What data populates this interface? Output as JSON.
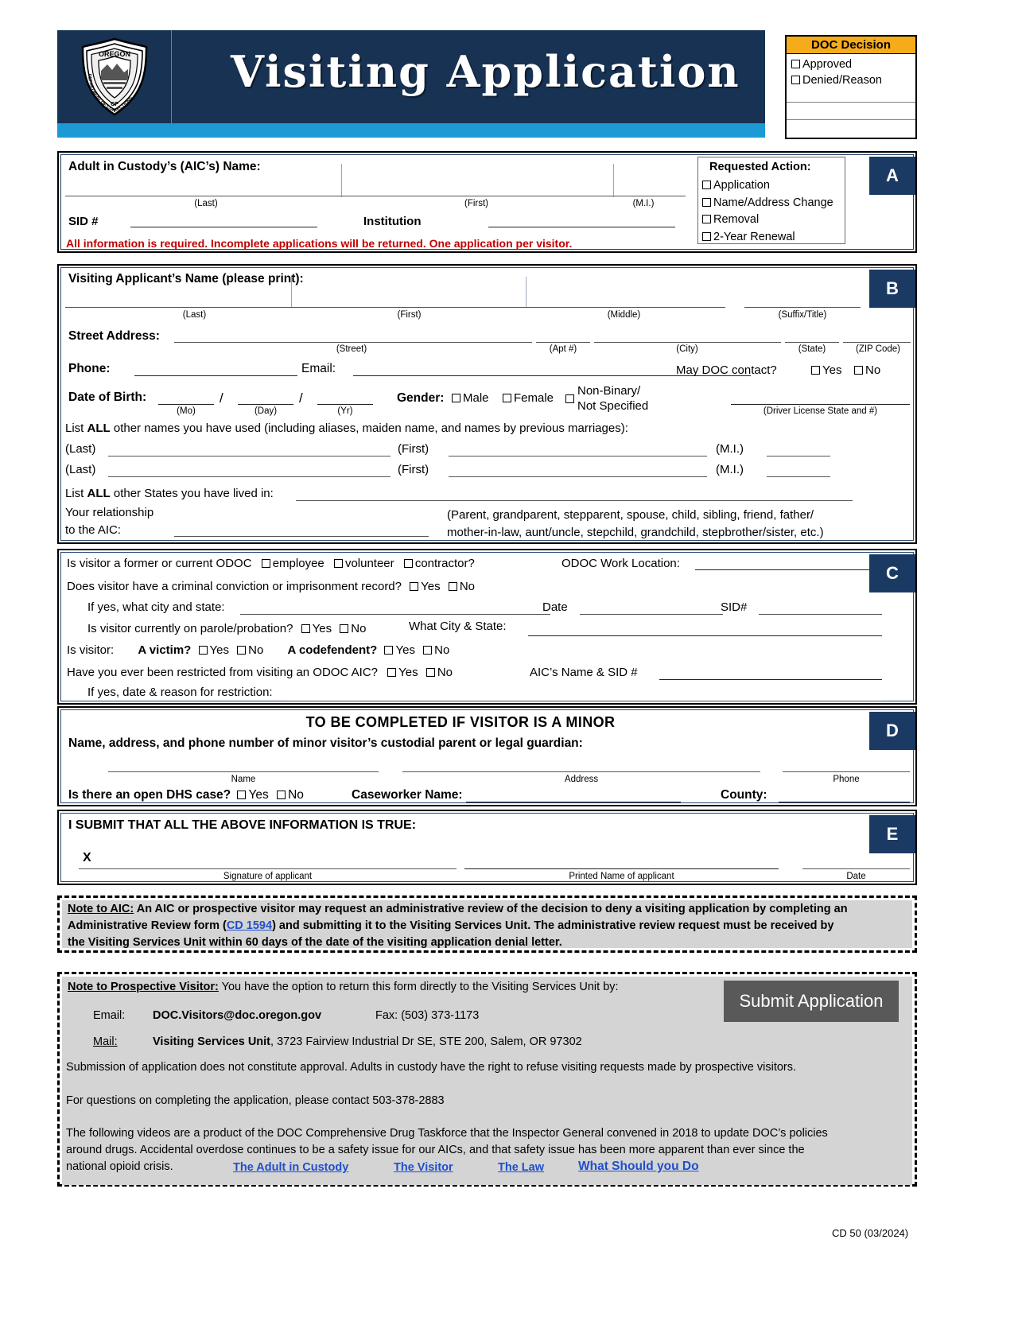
{
  "header": {
    "title": "Visiting Application",
    "logo_alt": "oregon-department-of-corrections-seal",
    "logo_text_top": "OREGON",
    "logo_text_arc": "DEPARTMENT OF CORRECTIONS",
    "logo_text_bottom": "OF"
  },
  "doc_decision": {
    "title": "DOC Decision",
    "options": [
      "Approved",
      "Denied/Reason"
    ]
  },
  "section_a": {
    "tag": "A",
    "aic_name_label": "Adult in Custody’s (AIC’s) Name:",
    "captions": [
      "(Last)",
      "(First)",
      "(M.I.)"
    ],
    "sid_label": "SID #",
    "institution_label": "Institution",
    "warning": "All information is required. Incomplete applications will be returned. One application per visitor.",
    "requested_action": {
      "title": "Requested Action:",
      "options": [
        "Application",
        "Name/Address Change",
        "Removal",
        "2-Year Renewal"
      ]
    }
  },
  "section_b": {
    "tag": "B",
    "applicant_name_label": "Visiting Applicant’s Name (please print):",
    "name_captions": [
      "(Last)",
      "(First)",
      "(Middle)",
      "(Suffix/Title)"
    ],
    "street_address_label": "Street Address:",
    "address_captions": [
      "(Street)",
      "(Apt #)",
      "(City)",
      "(State)",
      "(ZIP Code)"
    ],
    "phone_label": "Phone:",
    "email_label": "Email:",
    "may_doc_contact_label": "May DOC contact?",
    "yes_label": "Yes",
    "no_label": "No",
    "dob_label": "Date of Birth:",
    "dob_captions": [
      "(Mo)",
      "(Day)",
      "(Yr)"
    ],
    "gender_label": "Gender:",
    "gender_options": [
      "Male",
      "Female"
    ],
    "gender_nonbinary_line1": "Non-Binary/",
    "gender_nonbinary_line2": "Not Specified",
    "driver_license_caption": "(Driver License State and #)",
    "other_names_prefix": "List ",
    "other_names_all": "ALL",
    "other_names_suffix": " other names you have used (including aliases, maiden name, and names by previous marriages):",
    "name_row_labels": [
      "(Last)",
      "(First)",
      "(M.I.)"
    ],
    "other_states_prefix": "List ",
    "other_states_all": "ALL",
    "other_states_suffix": " other States you have lived in:",
    "relationship_line1": "Your relationship",
    "relationship_line2": "to the AIC:",
    "relationship_hint_line1": "(Parent, grandparent, stepparent, spouse, child, sibling, friend, father/",
    "relationship_hint_line2": "mother-in-law, aunt/uncle, stepchild, grandchild, stepbrother/sister, etc.)"
  },
  "section_c": {
    "tag": "C",
    "odoc_q": "Is visitor a former or current ODOC",
    "odoc_options": [
      "employee",
      "volunteer",
      "contractor?"
    ],
    "work_location_label": "ODOC Work Location:",
    "conviction_q": "Does visitor have a criminal conviction or imprisonment record?",
    "yes_label": "Yes",
    "no_label": "No",
    "if_yes_city_state": "If yes, what city and state:",
    "date_label": "Date",
    "sid_label": "SID#",
    "parole_q": "Is visitor currently on parole/probation?",
    "what_city_state": "What City & State:",
    "is_visitor_label": "Is visitor:",
    "victim_label": "A victim?",
    "codefendent_label": "A codefendent?",
    "restricted_q": "Have you ever been restricted from visiting an ODOC AIC?",
    "aic_name_sid_label": "AIC’s Name & SID #",
    "if_yes_restriction": "If yes, date & reason for restriction:"
  },
  "section_d": {
    "tag": "D",
    "title": "TO BE COMPLETED IF VISITOR IS A MINOR",
    "subtitle": "Name, address, and phone number of minor visitor’s custodial parent or legal guardian:",
    "captions": [
      "Name",
      "Address",
      "Phone"
    ],
    "dhs_q": "Is there an open DHS case?",
    "yes_label": "Yes",
    "no_label": "No",
    "caseworker_label": "Caseworker Name:",
    "county_label": "County:"
  },
  "section_e": {
    "tag": "E",
    "submit_statement": "I SUBMIT THAT ALL THE ABOVE INFORMATION IS TRUE:",
    "x_mark": "X",
    "captions": [
      "Signature of applicant",
      "Printed Name of applicant",
      "Date"
    ]
  },
  "note_to_aic": {
    "label": "Note to AIC:",
    "text_1": " An AIC or prospective visitor may request an administrative review of the decision to deny a visiting application by completing an",
    "text_2": "Administrative Review form (",
    "link": "CD 1594",
    "text_3": ") and submitting it to the Visiting Services Unit. The administrative review request must be received by",
    "text_4": "the Visiting Services Unit within 60 days of the date of the visiting application denial letter."
  },
  "note_to_visitor": {
    "label": "Note to Prospective Visitor:",
    "intro": "  You have the option to return this form directly to the Visiting Services Unit by:",
    "email_label": "Email:",
    "email_value": "DOC.Visitors@doc.oregon.gov",
    "fax_value": "Fax: (503) 373-1173",
    "mail_label": "Mail:",
    "mail_bold": "Visiting Services Unit",
    "mail_rest": ", 3723 Fairview Industrial Dr SE, STE 200, Salem, OR  97302",
    "disclaimer": "Submission of application does not constitute approval.  Adults in custody have the right to refuse visiting requests made by prospective visitors.",
    "questions": "For questions on completing the application, please contact 503-378-2883",
    "videos_line1": "The following videos are a product of the DOC Comprehensive Drug Taskforce that the Inspector General convened in 2018 to update DOC’s policies",
    "videos_line2": "around drugs.  Accidental overdose continues to be a safety issue for our AICs, and that safety issue has been more apparent than ever since the",
    "videos_line3": "national opioid crisis.",
    "links": [
      "The Adult in Custody",
      "The Visitor",
      "The Law",
      "What Should you Do"
    ],
    "submit_button": "Submit Application"
  },
  "footer": {
    "form_code": "CD 50 (03/2024)"
  },
  "colors": {
    "header_navy": "#183254",
    "header_cyan": "#1b9ad6",
    "tag_navy": "#1b3a63",
    "doc_decision_orange": "#f5ab1a",
    "warning_red": "#c00000",
    "link_blue": "#1f4fcc",
    "submit_gray": "#595959",
    "note_gray": "#d4d4d4"
  }
}
